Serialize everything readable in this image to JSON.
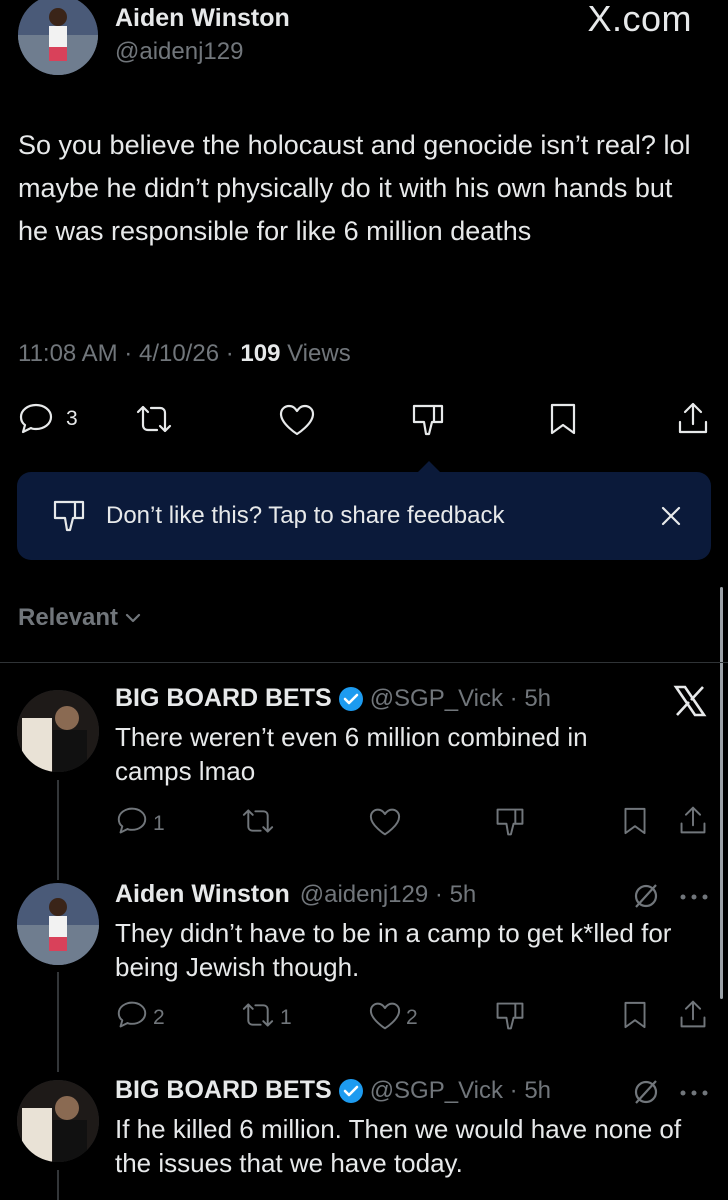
{
  "brand": "X.com",
  "tweet": {
    "author_name": "Aiden Winston",
    "author_handle": "@aidenj129",
    "text": "So you believe the holocaust and genocide isn’t real? lol maybe he didn’t physically do it with his own hands but he was responsible for like 6 million deaths",
    "time": "11:08 AM",
    "date": "4/10/26",
    "views_count": "109",
    "views_label": "Views",
    "reply_count": "3"
  },
  "feedback": {
    "text": "Don’t like this? Tap to share feedback"
  },
  "sort": {
    "label": "Relevant"
  },
  "replies": [
    {
      "name": "BIG BOARD BETS",
      "handle": "@SGP_Vick",
      "time": "5h",
      "text": "There weren’t even 6 million combined in camps lmao",
      "replies": "1",
      "reposts": "",
      "likes": ""
    },
    {
      "name": "Aiden Winston",
      "handle": "@aidenj129",
      "time": "5h",
      "text": "They didn’t have to be in a camp to get k*lled for being Jewish though.",
      "replies": "2",
      "reposts": "1",
      "likes": "2"
    },
    {
      "name": "BIG BOARD BETS",
      "handle": "@SGP_Vick",
      "time": "5h",
      "text": "If he killed 6 million. Then we would have none of the issues that we have today.",
      "replies": "",
      "reposts": "",
      "likes": ""
    }
  ],
  "colors": {
    "background": "#000000",
    "text": "#e7e9ea",
    "muted": "#71767b",
    "feedback_bg": "#0b1a3a",
    "verified": "#1d9bf0"
  },
  "icons": [
    "reply-icon",
    "repost-icon",
    "like-icon",
    "dislike-icon",
    "bookmark-icon",
    "share-icon",
    "close-icon",
    "chevron-down-icon",
    "verified-badge-icon",
    "x-logo-icon",
    "grok-icon",
    "more-icon"
  ]
}
